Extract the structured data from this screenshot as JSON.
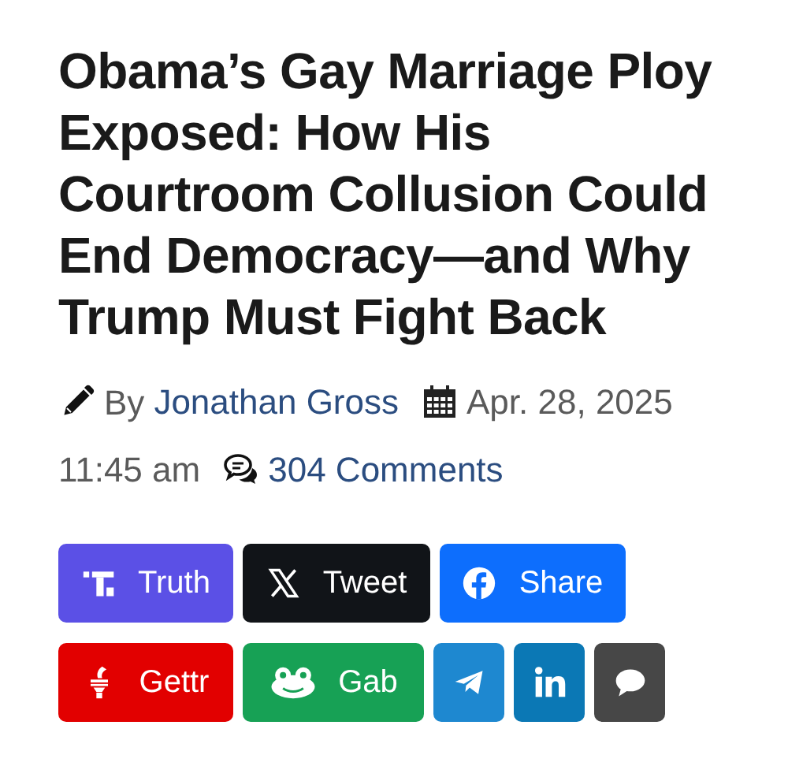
{
  "headline": "Obama’s Gay Marriage Ploy Exposed: How His Courtroom Collusion Could End Democracy—and Why Trump Must Fight Back",
  "byline": {
    "prefix": "By",
    "author": "Jonathan Gross",
    "date": "Apr. 28, 2025",
    "time": "11:45 am",
    "comments": "304 Comments"
  },
  "share_buttons": [
    {
      "kind": "truth",
      "label": "Truth",
      "color": "#5b50e6"
    },
    {
      "kind": "x",
      "label": "Tweet",
      "color": "#111418"
    },
    {
      "kind": "facebook",
      "label": "Share",
      "color": "#0d6efd"
    },
    {
      "kind": "gettr",
      "label": "Gettr",
      "color": "#e20000"
    },
    {
      "kind": "gab",
      "label": "Gab",
      "color": "#17a155"
    },
    {
      "kind": "telegram",
      "color": "#1e88d0"
    },
    {
      "kind": "linkedin",
      "color": "#0b78b5"
    },
    {
      "kind": "comment",
      "color": "#474747"
    }
  ]
}
